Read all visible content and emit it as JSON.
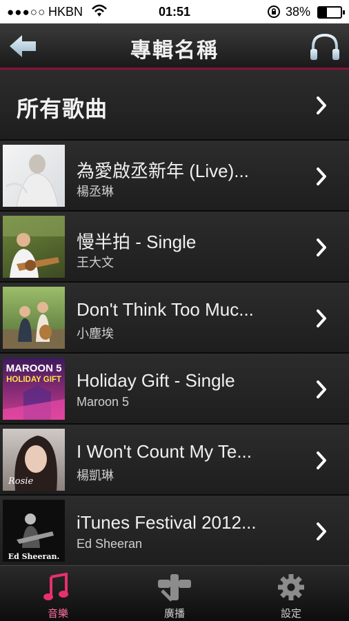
{
  "status_bar": {
    "signal": "●●●○○",
    "carrier": "HKBN",
    "time": "01:51",
    "battery": "38%",
    "battery_level": 0.38,
    "icons": [
      "signal-icon",
      "wifi-icon",
      "rotation-lock-icon",
      "battery-icon"
    ]
  },
  "nav": {
    "title": "專輯名稱",
    "back_icon": "back-arrow-icon",
    "right_icon": "headphones-icon"
  },
  "all_songs": {
    "label": "所有歌曲"
  },
  "albums": [
    {
      "title": "為愛啟丞新年 (Live)...",
      "artist": "楊丞琳"
    },
    {
      "title": "慢半拍 - Single",
      "artist": "王大文"
    },
    {
      "title": "Don't Think Too Muc...",
      "artist": "小塵埃"
    },
    {
      "title": "Holiday Gift - Single",
      "artist": "Maroon 5",
      "cover_text_1": "MAROON 5",
      "cover_text_2": "HOLIDAY GIFT"
    },
    {
      "title": "I Won't Count My Te...",
      "artist": "楊凱琳",
      "cover_text_1": "Rosie"
    },
    {
      "title": "iTunes Festival 2012...",
      "artist": "Ed Sheeran",
      "cover_text_1": "Ed Sheeran."
    }
  ],
  "tabs": [
    {
      "label": "音樂",
      "icon": "music-note-icon",
      "active": true
    },
    {
      "label": "廣播",
      "icon": "broadcast-icon",
      "active": false
    },
    {
      "label": "設定",
      "icon": "gear-icon",
      "active": false
    }
  ],
  "colors": {
    "accent": "#e8306e",
    "nav_divider": "#8a1238",
    "background": "#1e1e1e"
  }
}
